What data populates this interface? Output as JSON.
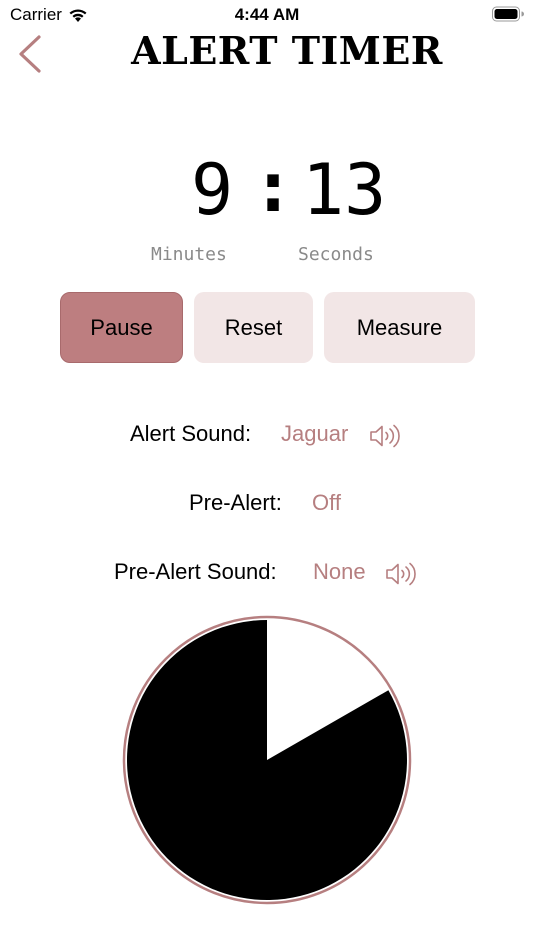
{
  "status_bar": {
    "carrier": "Carrier",
    "time": "4:44 AM",
    "wifi_icon": "wifi-icon",
    "battery_icon": "battery-icon"
  },
  "nav": {
    "back_icon": "chevron-left-icon",
    "title": "ALERT TIMER"
  },
  "timer": {
    "minutes": "9",
    "separator": ":",
    "seconds": "13",
    "minutes_label": "Minutes",
    "seconds_label": "Seconds",
    "elapsed_fraction": 0.167
  },
  "buttons": {
    "pause": "Pause",
    "reset": "Reset",
    "measure": "Measure"
  },
  "settings": {
    "alert_sound_label": "Alert Sound:",
    "alert_sound_value": "Jaguar",
    "pre_alert_label": "Pre-Alert:",
    "pre_alert_value": "Off",
    "pre_alert_sound_label": "Pre-Alert Sound:",
    "pre_alert_sound_value": "None",
    "speaker_icon": "speaker-icon"
  },
  "colors": {
    "accent": "#b67f80",
    "pause_button": "#bd7e80",
    "secondary_button": "#f2e6e6",
    "pie_fill": "#000000",
    "pie_ring": "#b67f80"
  }
}
